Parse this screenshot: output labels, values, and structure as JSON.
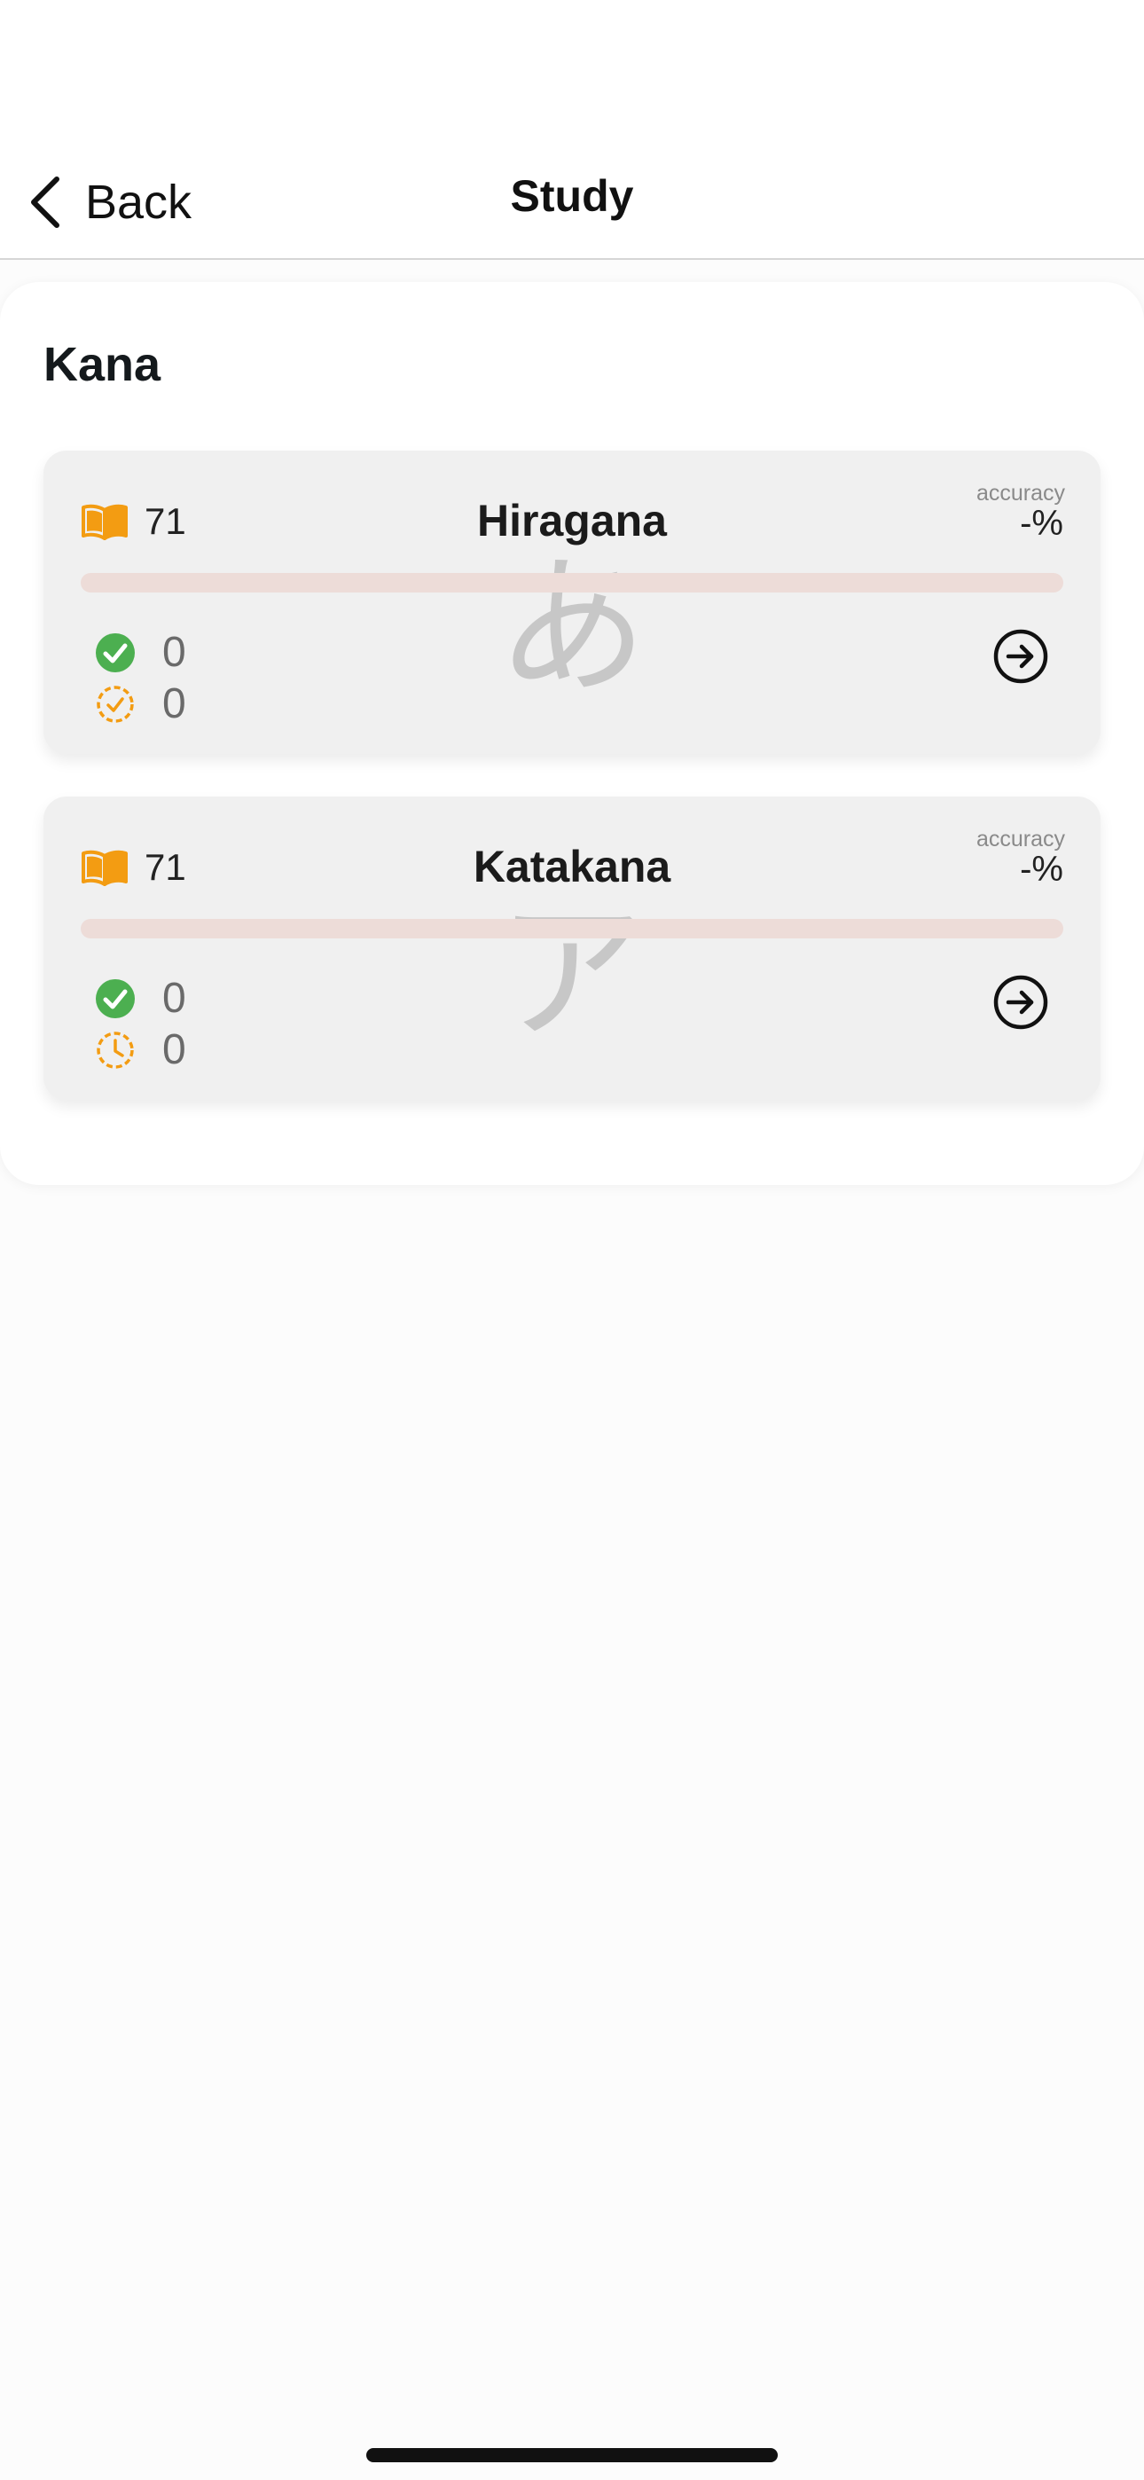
{
  "nav": {
    "back_label": "Back",
    "title": "Study"
  },
  "section": {
    "title": "Kana"
  },
  "cards": [
    {
      "title": "Hiragana",
      "glyph": "あ",
      "count": "71",
      "accuracy_label": "accuracy",
      "accuracy_value": "-%",
      "progress_fraction": 0,
      "learned": "0",
      "review": "0",
      "icons": [
        "open-book-icon",
        "check-circle-icon",
        "dashed-check-circle-icon",
        "arrow-right-circle-icon"
      ]
    },
    {
      "title": "Katakana",
      "glyph": "ア",
      "count": "71",
      "accuracy_label": "accuracy",
      "accuracy_value": "-%",
      "progress_fraction": 0,
      "learned": "0",
      "review": "0",
      "icons": [
        "open-book-icon",
        "check-circle-icon",
        "dashed-clock-icon",
        "arrow-right-circle-icon"
      ]
    }
  ],
  "colors": {
    "accent_orange": "#f39c12",
    "success_green": "#4caf50",
    "progress_track": "#eddcd8",
    "card_bg": "#f0f0f0"
  }
}
